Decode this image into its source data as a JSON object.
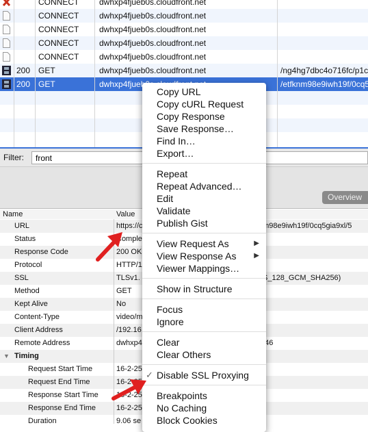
{
  "requests": [
    {
      "icon": "error-x-icon",
      "status": "",
      "method": "CONNECT",
      "host": "dwhxp4fjueb0s.cloudfront.net",
      "path": ""
    },
    {
      "icon": "document-icon",
      "status": "",
      "method": "CONNECT",
      "host": "dwhxp4fjueb0s.cloudfront.net",
      "path": ""
    },
    {
      "icon": "document-icon",
      "status": "",
      "method": "CONNECT",
      "host": "dwhxp4fjueb0s.cloudfront.net",
      "path": ""
    },
    {
      "icon": "document-icon",
      "status": "",
      "method": "CONNECT",
      "host": "dwhxp4fjueb0s.cloudfront.net",
      "path": ""
    },
    {
      "icon": "document-icon",
      "status": "",
      "method": "CONNECT",
      "host": "dwhxp4fjueb0s.cloudfront.net",
      "path": ""
    },
    {
      "icon": "film-icon",
      "status": "200",
      "method": "GET",
      "host": "dwhxp4fjueb0s.cloudfront.net",
      "path": "/ng4hg7dbc4o716fc/p1c"
    },
    {
      "icon": "film-icon",
      "status": "200",
      "method": "GET",
      "host": "dwhxp4fjueb0s.cloudfront.net",
      "path": "/etfknm98e9iwh19f/0cq5",
      "selected": true
    }
  ],
  "filter": {
    "label": "Filter:",
    "value": "front"
  },
  "overview_tab": "Overview",
  "details": {
    "headers": {
      "name": "Name",
      "value": "Value"
    },
    "rows": [
      {
        "name": "URL",
        "value": "https://c",
        "value_right": "nm98e9iwh19f/0cq5gia9xl/5"
      },
      {
        "name": "Status",
        "value": "Comple",
        "value_right": ""
      },
      {
        "name": "Response Code",
        "value": "200 OK",
        "value_right": ""
      },
      {
        "name": "Protocol",
        "value": "HTTP/1",
        "value_right": ""
      },
      {
        "name": "SSL",
        "value": "TLSv1.",
        "value_right": "S_128_GCM_SHA256)"
      },
      {
        "name": "Method",
        "value": "GET",
        "value_right": ""
      },
      {
        "name": "Kept Alive",
        "value": "No",
        "value_right": ""
      },
      {
        "name": "Content-Type",
        "value": "video/m",
        "value_right": ""
      },
      {
        "name": "Client Address",
        "value": "/192.16",
        "value_right": ""
      },
      {
        "name": "Remote Address",
        "value": "dwhxp4",
        "value_right": "4.46"
      },
      {
        "name": "Timing",
        "value": "",
        "value_right": "",
        "group": true
      },
      {
        "name": "Request Start Time",
        "value": "16-2-25",
        "value_right": "",
        "indent": true
      },
      {
        "name": "Request End Time",
        "value": "16-2-25",
        "value_right": "",
        "indent": true
      },
      {
        "name": "Response Start Time",
        "value": "16-2-25",
        "value_right": "",
        "indent": true
      },
      {
        "name": "Response End Time",
        "value": "16-2-25",
        "value_right": "",
        "indent": true
      },
      {
        "name": "Duration",
        "value": "9.06 se",
        "value_right": "",
        "indent": true
      }
    ]
  },
  "context_menu": {
    "groups": [
      [
        "Copy URL",
        "Copy cURL Request",
        "Copy Response",
        "Save Response…",
        "Find In…",
        "Export…"
      ],
      [
        "Repeat",
        "Repeat Advanced…",
        "Edit",
        "Validate",
        "Publish Gist"
      ],
      [
        "View Request As",
        "View Response As",
        "Viewer Mappings…"
      ],
      [
        "Show in Structure"
      ],
      [
        "Focus",
        "Ignore"
      ],
      [
        "Clear",
        "Clear Others"
      ],
      [
        "Disable SSL Proxying"
      ],
      [
        "Breakpoints",
        "No Caching",
        "Block Cookies"
      ]
    ],
    "submenu_items": [
      "View Request As",
      "View Response As"
    ],
    "checked_items": [
      "Disable SSL Proxying"
    ]
  },
  "colors": {
    "selection": "#3a72d8",
    "annotation_arrow": "#e02020"
  }
}
